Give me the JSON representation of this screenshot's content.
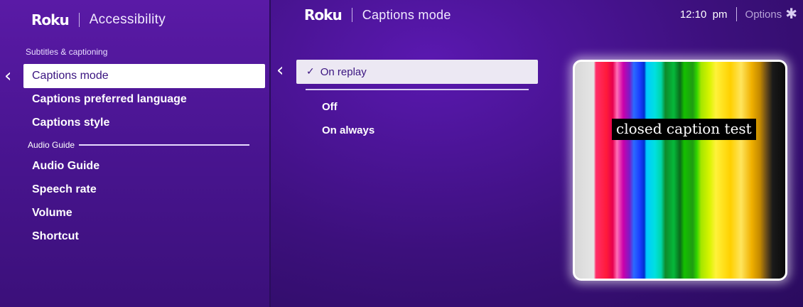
{
  "left": {
    "logo": "Roku",
    "title": "Accessibility",
    "section_label": "Subtitles & captioning",
    "items": [
      {
        "label": "Captions mode"
      },
      {
        "label": "Captions preferred language"
      },
      {
        "label": "Captions style"
      }
    ],
    "audio_section_label": "Audio Guide",
    "audio_items": [
      {
        "label": "Audio Guide"
      },
      {
        "label": "Speech rate"
      },
      {
        "label": "Volume"
      },
      {
        "label": "Shortcut"
      }
    ]
  },
  "right": {
    "logo": "Roku",
    "title": "Captions mode",
    "clock": "12:10  pm",
    "options_label": "Options",
    "options_glyph": "✱",
    "selected_option": "On replay",
    "options": [
      {
        "label": "Off"
      },
      {
        "label": "On always"
      }
    ],
    "preview_caption": "closed caption test"
  },
  "icons": {
    "back": "chevron-left-icon",
    "check": "check-icon",
    "options": "asterisk-icon"
  }
}
